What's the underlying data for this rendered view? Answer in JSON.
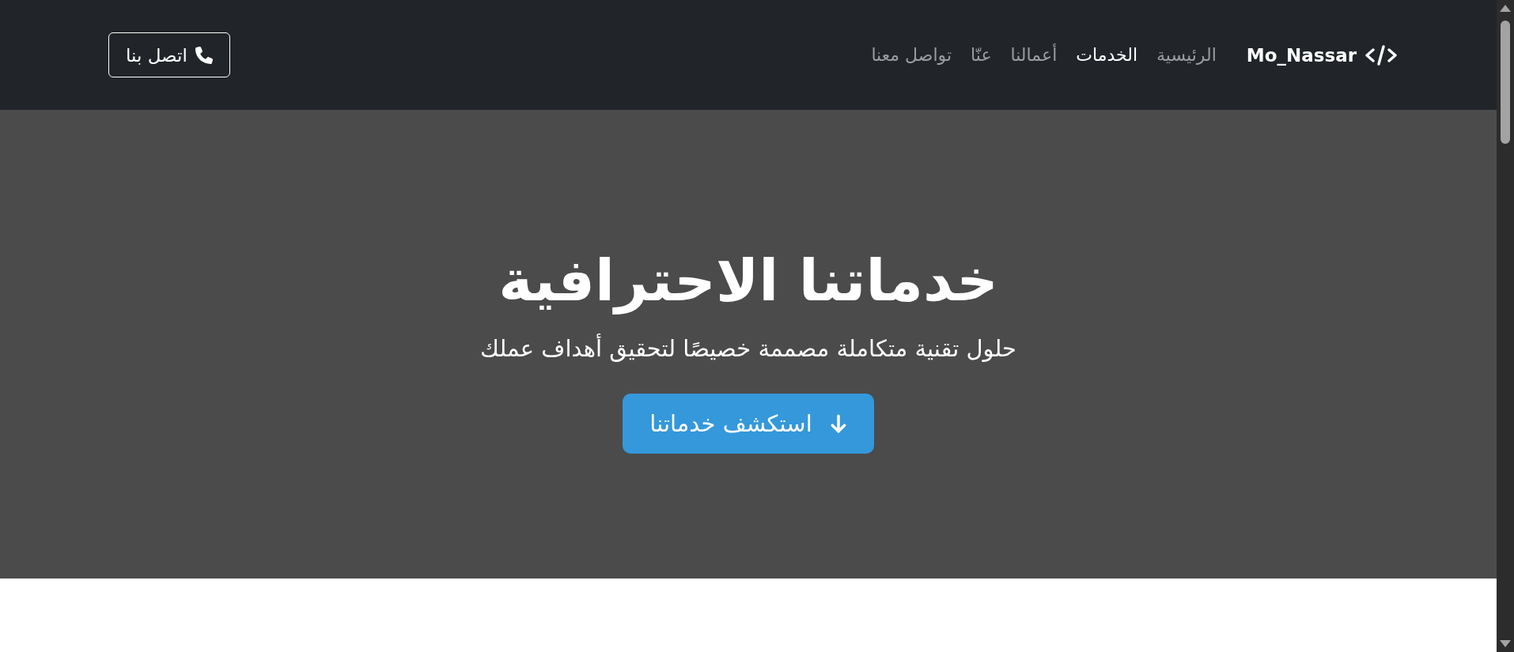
{
  "navbar": {
    "brand": {
      "text": "Mo_Nassar"
    },
    "links": [
      {
        "label": "الرئيسية",
        "selected": false
      },
      {
        "label": "الخدمات",
        "selected": true
      },
      {
        "label": "أعمالنا",
        "selected": false
      },
      {
        "label": "عنّا",
        "selected": false
      },
      {
        "label": "تواصل معنا",
        "selected": false
      }
    ],
    "contact_button": {
      "label": "اتصل بنا"
    }
  },
  "hero": {
    "title": "خدماتنا الاحترافية",
    "subtitle": "حلول تقنية متكاملة مصممة خصيصًا لتحقيق أهداف عملك",
    "button": {
      "label": "استكشف خدماتنا"
    }
  }
}
